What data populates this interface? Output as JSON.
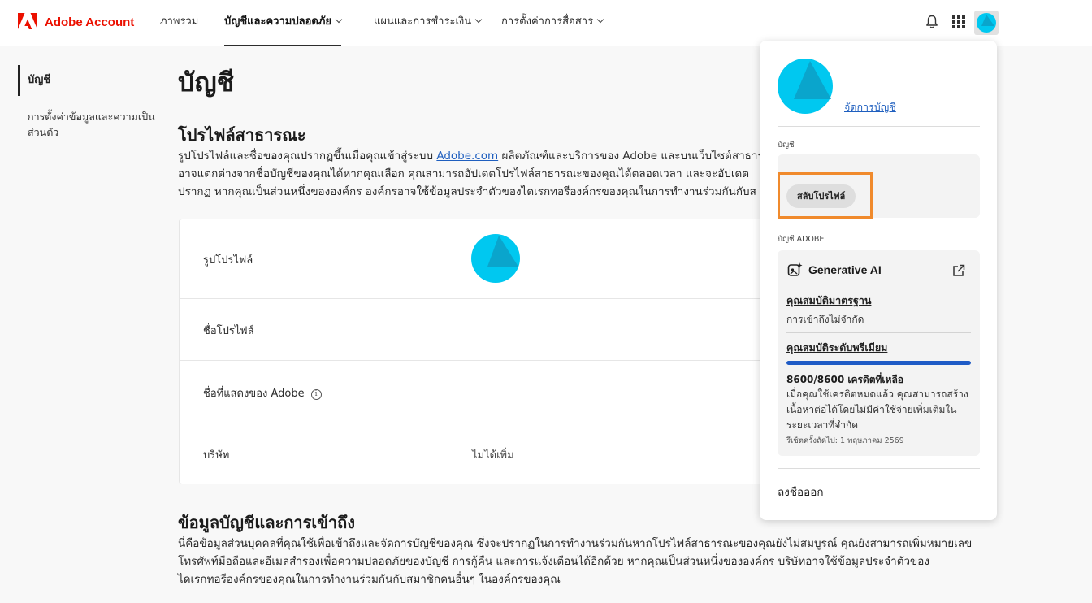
{
  "brand": {
    "name": "Adobe Account",
    "color": "#eb1000"
  },
  "nav": {
    "items": [
      {
        "label": "ภาพรวม",
        "dropdown": false,
        "active": false
      },
      {
        "label": "บัญชีและความปลอดภัย",
        "dropdown": true,
        "active": true
      },
      {
        "label": "แผนและการชำระเงิน",
        "dropdown": true,
        "active": false
      },
      {
        "label": "การตั้งค่าการสื่อสาร",
        "dropdown": true,
        "active": false
      }
    ],
    "icons": [
      "bell-icon",
      "apps-grid-icon",
      "avatar"
    ]
  },
  "sidebar": {
    "items": [
      {
        "label": "บัญชี",
        "active": true
      },
      {
        "label": "การตั้งค่าข้อมูลและความเป็นส่วนตัว",
        "active": false
      }
    ]
  },
  "main": {
    "title": "บัญชี",
    "public_profile": {
      "heading": "โปรไฟล์สาธารณะ",
      "line1_before": "รูปโปรไฟล์และชื่อของคุณปรากฏขึ้นเมื่อคุณเข้าสู่ระบบ ",
      "line1_link": "Adobe.com",
      "line1_after": " ผลิตภัณฑ์และบริการของ Adobe และบนเว็บไซต์สาธารณ",
      "line2": "อาจแตกต่างจากชื่อบัญชีของคุณได้หากคุณเลือก คุณสามารถอัปเดตโปรไฟล์สาธารณะของคุณได้ตลอดเวลา และจะอัปเดต",
      "line3": "ปรากฏ หากคุณเป็นส่วนหนึ่งขององค์กร องค์กรอาจใช้ข้อมูลประจำตัวของไดเรกทอรีองค์กรของคุณในการทำงานร่วมกันกับส"
    },
    "profile_rows": [
      {
        "label": "รูปโปรไฟล์",
        "value": ""
      },
      {
        "label": "ชื่อโปรไฟล์",
        "value": ""
      },
      {
        "label": "ชื่อที่แสดงของ Adobe",
        "value": "",
        "info_icon": "info-icon"
      },
      {
        "label": "บริษัท",
        "value": "ไม่ได้เพิ่ม"
      }
    ],
    "account_info": {
      "heading": "ข้อมูลบัญชีและการเข้าถึง",
      "line1": "นี่คือข้อมูลส่วนบุคคลที่คุณใช้เพื่อเข้าถึงและจัดการบัญชีของคุณ ซึ่งจะปรากฏในการทำงานร่วมกันหากโปรไฟล์สาธารณะของคุณยังไม่สมบูรณ์ คุณยังสามารถเพิ่มหมายเลข",
      "line2": "โทรศัพท์มือถือและอีเมลสำรองเพื่อความปลอดภัยของบัญชี การกู้คืน และการแจ้งเตือนได้อีกด้วย หากคุณเป็นส่วนหนึ่งขององค์กร บริษัทอาจใช้ข้อมูลประจำตัวของ",
      "line3": "ไดเรกทอรีองค์กรของคุณในการทำงานร่วมกันกับสมาชิกคนอื่นๆ ในองค์กรของคุณ"
    }
  },
  "account_menu": {
    "manage_link": "จัดการบัญชี",
    "account_label": "บัญชี",
    "switch_profile": "สลับโปรไฟล์",
    "adobe_account_label": "บัญชี ADOBE",
    "generative_ai": {
      "title": "Generative AI",
      "standard_tier": "คุณสมบัติมาตรฐาน",
      "standard_desc": "การเข้าถึงไม่จำกัด",
      "premium_tier": "คุณสมบัติระดับพรีเมียม",
      "credits_used_fraction": 1.0,
      "credits_text": "8600/8600 เครดิตที่เหลือ",
      "credits_desc_1": "เมื่อคุณใช้เครดิตหมดแล้ว คุณสามารถสร้าง",
      "credits_desc_2": "เนื้อหาต่อได้โดยไม่มีค่าใช้จ่ายเพิ่มเติมใน",
      "credits_desc_3": "ระยะเวลาที่จำกัด",
      "reset_text": "รีเซ็ตครั้งถัดไป: 1 พฤษภาคม 2569"
    },
    "sign_out": "ลงชื่อออก"
  },
  "colors": {
    "accent_link": "#1f5fbf",
    "highlight": "#f08a2c",
    "progress": "#1e5bc6",
    "avatar": "#00c8f0"
  }
}
